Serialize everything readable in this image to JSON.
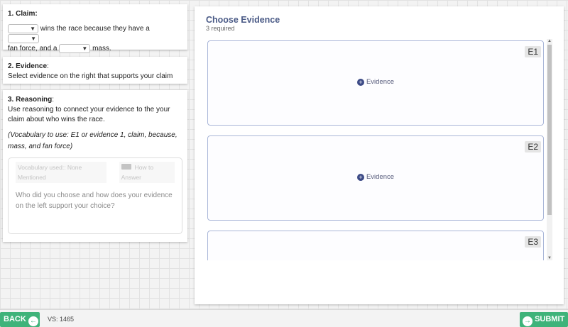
{
  "claim": {
    "header": "1. Claim:",
    "text_part1": "wins the race because they have a",
    "text_part2": "fan force, and a",
    "text_part3": "mass."
  },
  "evidence": {
    "header": "2. Evidence",
    "colon": ":",
    "instruction": "Select evidence on the right that supports your claim"
  },
  "reasoning": {
    "header": "3. Reasoning",
    "colon": ":",
    "instruction": "Use reasoning to connect your evidence to the your claim about who wins the race.",
    "vocab_hint": "(Vocabulary to use: E1 or evidence 1, claim, because, mass, and fan force)",
    "vocab_used": "Vocabulary used:: None Mentioned",
    "how_to_answer": "How to Answer",
    "placeholder": "Who did you choose and how does your evidence on the left support your choice?"
  },
  "choose_evidence": {
    "title": "Choose Evidence",
    "subtitle": "3 required",
    "add_label": "Evidence",
    "slots": [
      "E1",
      "E2",
      "E3"
    ]
  },
  "footer": {
    "back_label": "BACK",
    "vs_label": "VS: 1465",
    "submit_label": "SUBMIT"
  }
}
